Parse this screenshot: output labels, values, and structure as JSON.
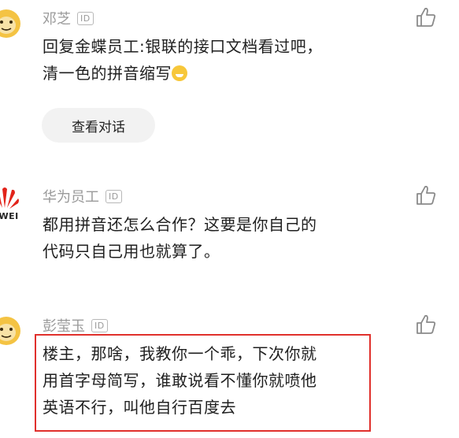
{
  "comments": [
    {
      "name": "邓芝",
      "id_badge": "ID",
      "text_line1": "回复金蝶员工:银联的接口文档看过吧，",
      "text_line2": "清一色的拼音缩写",
      "emoji": "grinning-sweat-emoji",
      "view_button": "查看对话"
    },
    {
      "name": "华为员工",
      "id_badge": "ID",
      "avatar_text": "AWEI",
      "text_line1": "都用拼音还怎么合作？这要是你自己的",
      "text_line2": "代码只自己用也就算了。"
    },
    {
      "name": "彭莹玉",
      "id_badge": "ID",
      "text_line1": "楼主，那啥，我教你一个乖，下次你就",
      "text_line2": "用首字母简写，谁敢说看不懂你就喷他",
      "text_line3": "英语不行，叫他自行百度去"
    }
  ],
  "colors": {
    "highlight": "#e0302c",
    "huawei_red": "#e2231a",
    "avatar_yellow": "#f4c343"
  },
  "icons": {
    "like": "thumbs-up-icon"
  }
}
